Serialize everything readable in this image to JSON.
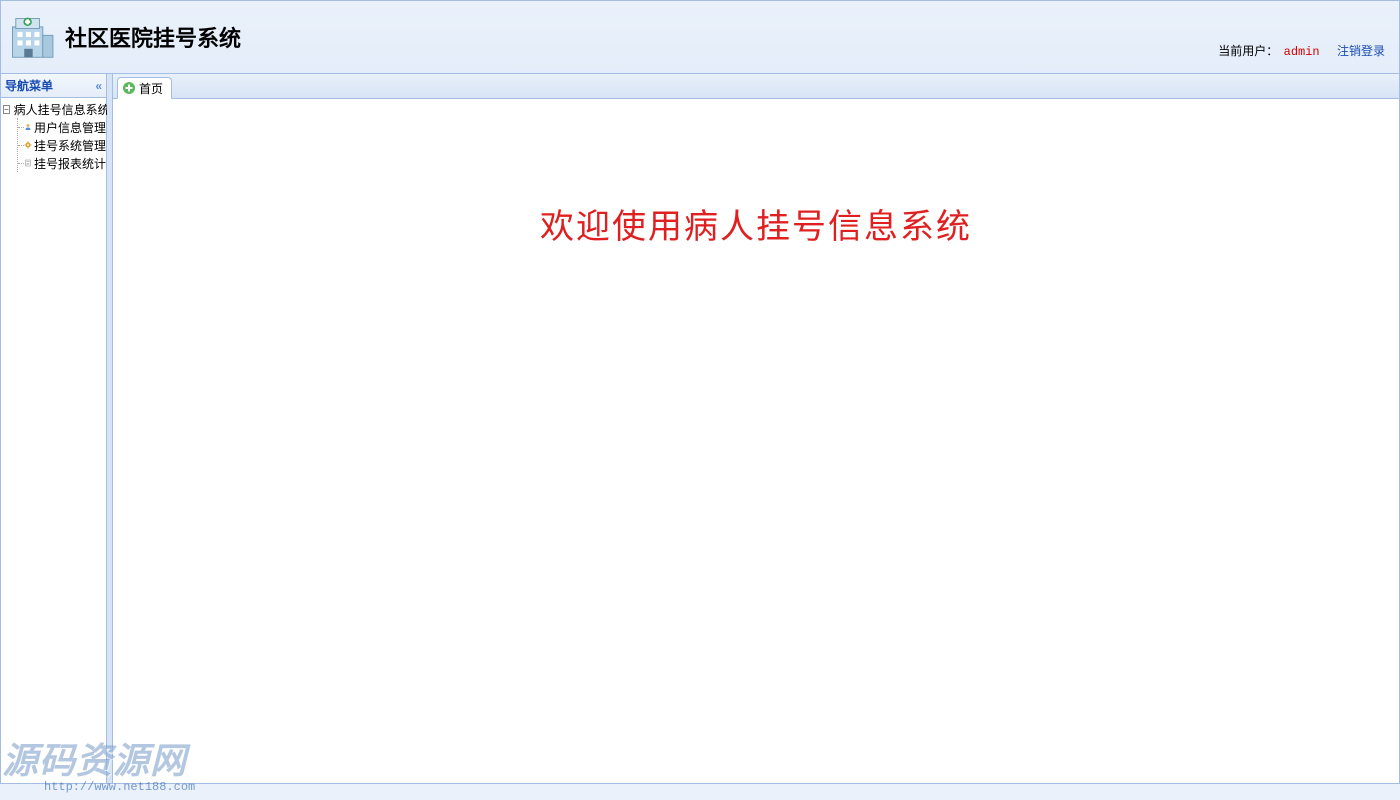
{
  "header": {
    "app_title": "社区医院挂号系统",
    "user_label": "当前用户：",
    "user_name": "admin",
    "logout_label": "注销登录"
  },
  "sidebar": {
    "title": "导航菜单",
    "root": {
      "label": "病人挂号信息系统",
      "expanded": true,
      "children": [
        {
          "label": "用户信息管理",
          "icon": "user-icon"
        },
        {
          "label": "挂号系统管理",
          "icon": "gear-icon"
        },
        {
          "label": "挂号报表统计",
          "icon": "report-icon"
        }
      ]
    }
  },
  "tabs": [
    {
      "label": "首页",
      "icon": "home-plus-icon",
      "active": true
    }
  ],
  "main": {
    "welcome": "欢迎使用病人挂号信息系统"
  },
  "watermark": {
    "text": "源码资源网",
    "url": "http://www.net188.com"
  }
}
